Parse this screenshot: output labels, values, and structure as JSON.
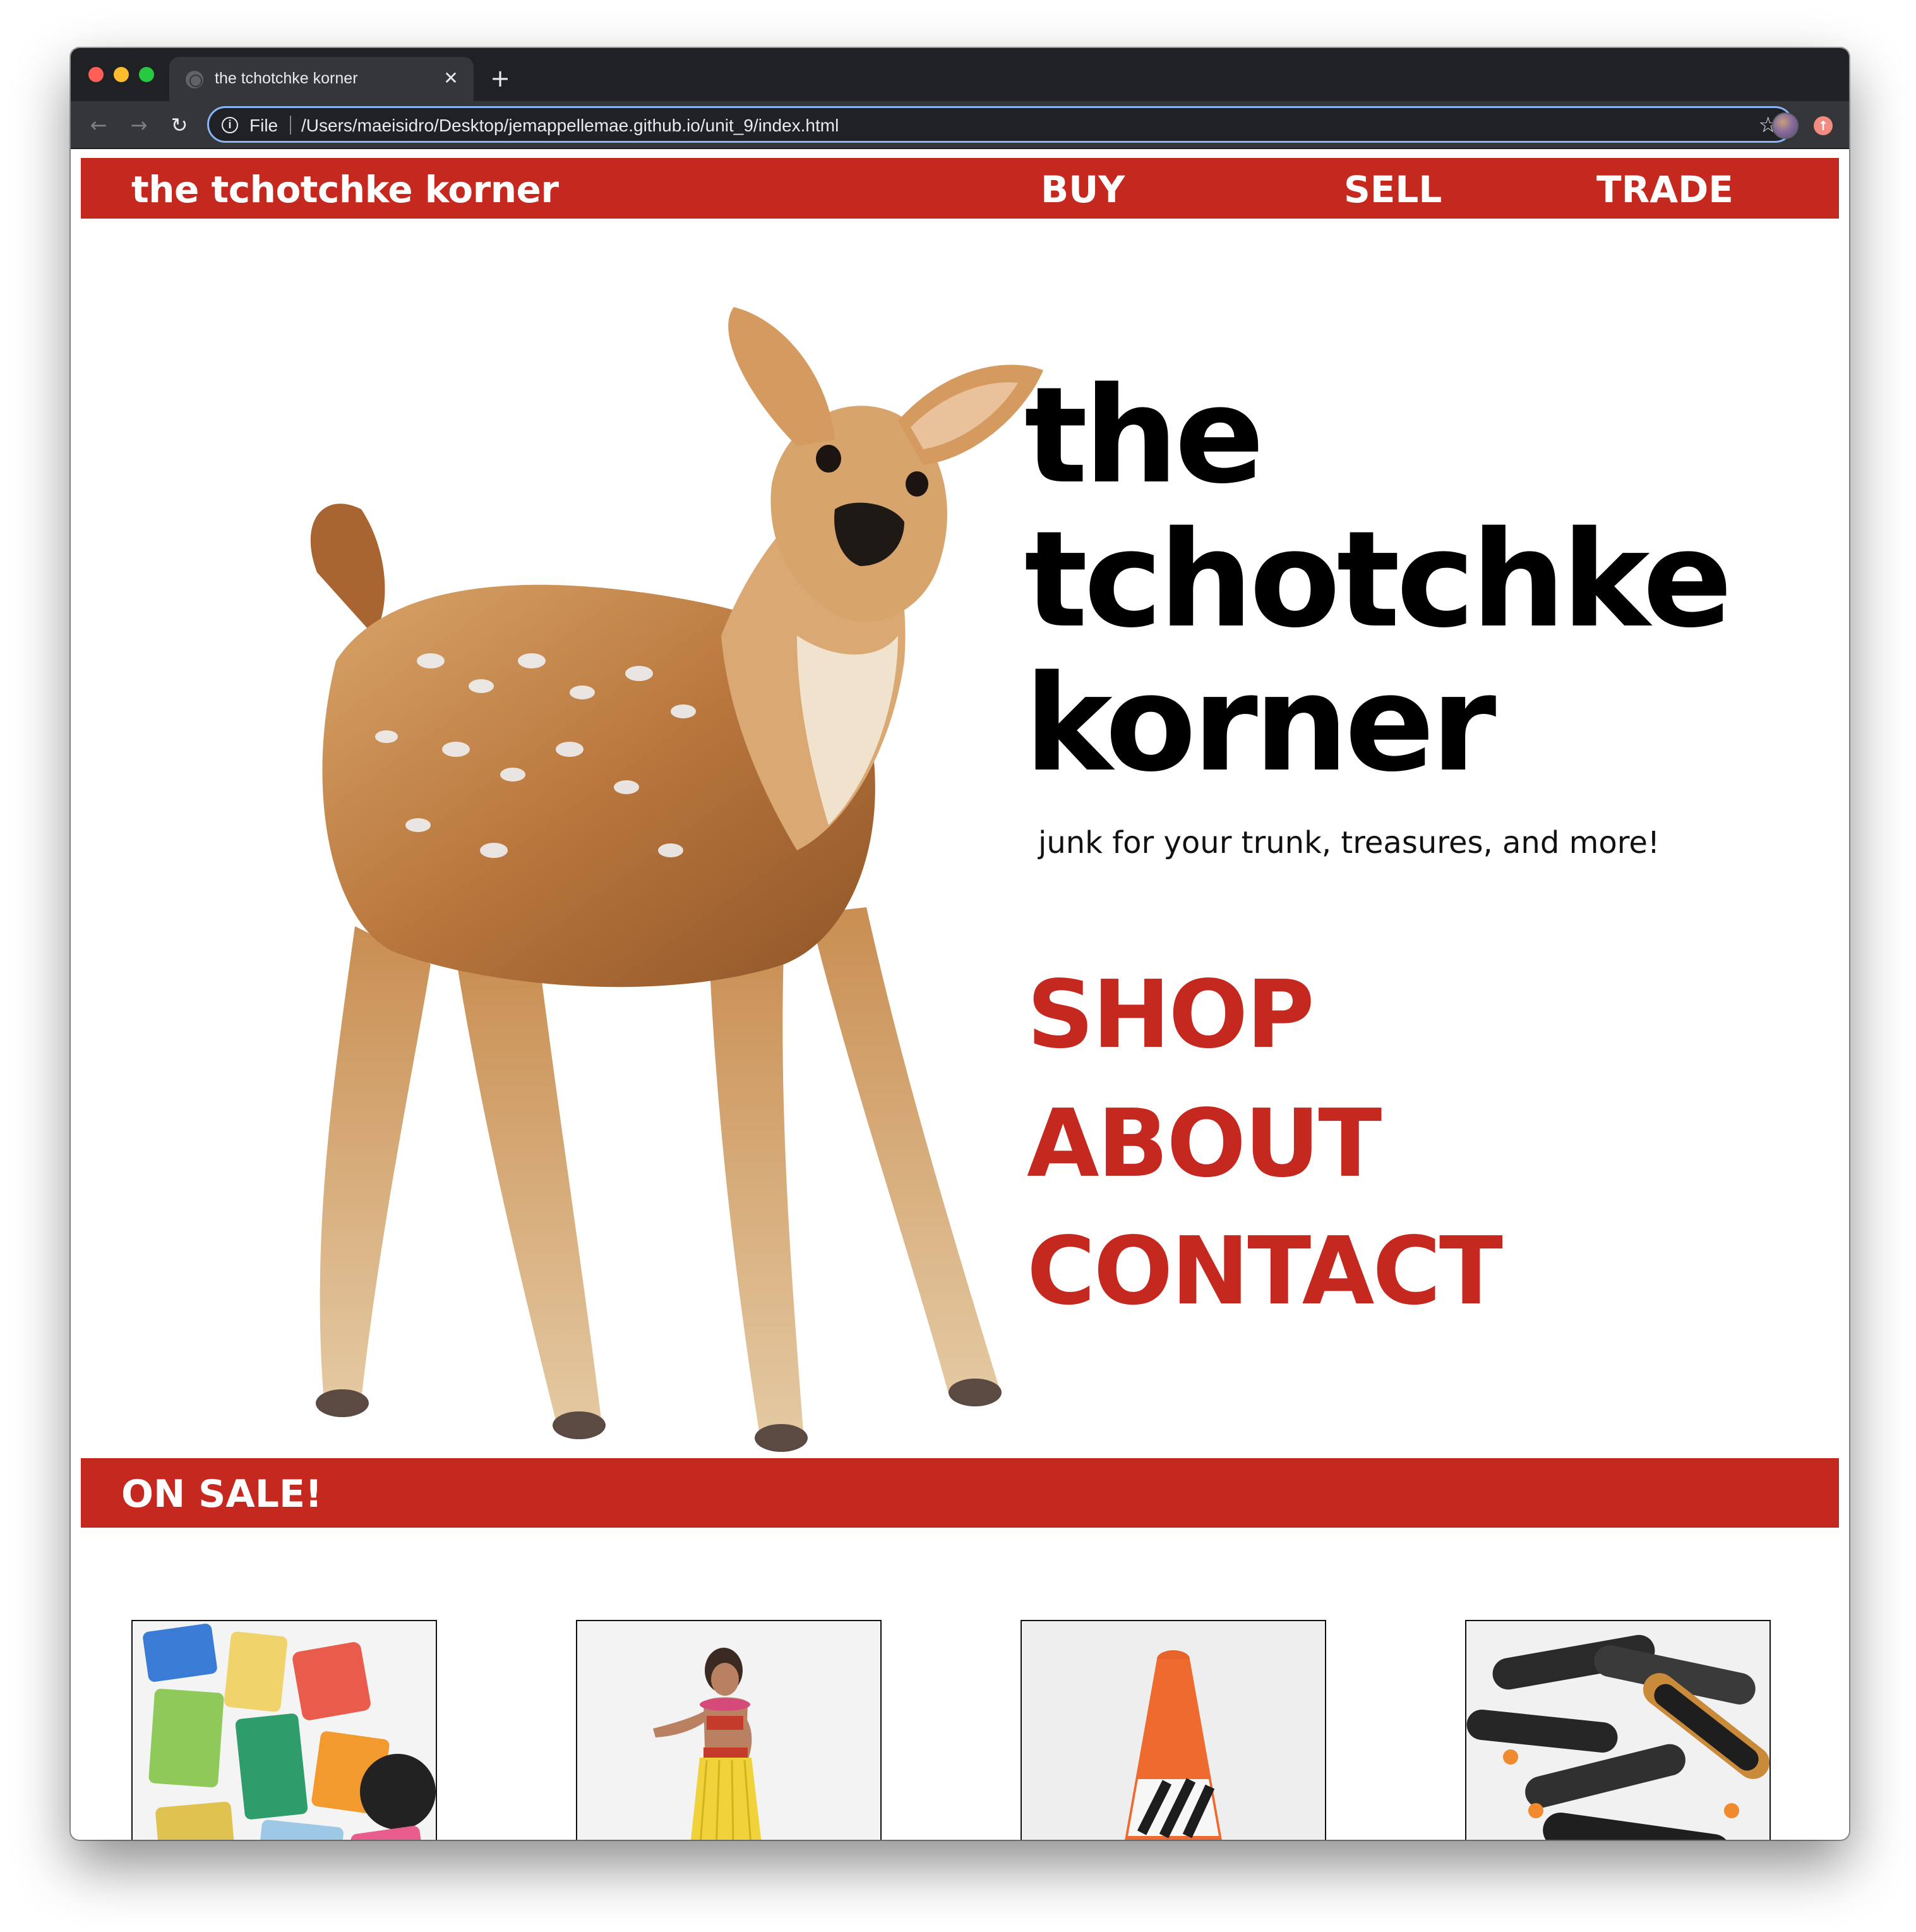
{
  "browser": {
    "tab_title": "the tchotchke korner",
    "tab_close": "✕",
    "new_tab": "+",
    "scheme_label": "File",
    "url": "/Users/maeisidro/Desktop/jemappellemae.github.io/unit_9/index.html",
    "icons": {
      "back": "arrow-left-icon",
      "forward": "arrow-right-icon",
      "reload": "reload-icon",
      "info": "info-icon",
      "bookmark": "star-icon",
      "update": "update-icon"
    }
  },
  "site": {
    "brand": "the tchotchke korner",
    "nav": [
      {
        "label": "BUY"
      },
      {
        "label": "SELL"
      },
      {
        "label": "TRADE"
      }
    ],
    "hero": {
      "title_lines": [
        "the",
        "tchotchke",
        "korner"
      ],
      "tagline": "junk for your trunk, treasures, and more!",
      "links": [
        {
          "label": "SHOP"
        },
        {
          "label": "ABOUT"
        },
        {
          "label": "CONTACT"
        }
      ]
    },
    "sale": {
      "title": "ON SALE!"
    },
    "products": [
      {
        "image": "sticker-collection"
      },
      {
        "image": "hula-dancer-figurine"
      },
      {
        "image": "traffic-cone"
      },
      {
        "image": "fingerboard-skateboards"
      }
    ],
    "colors": {
      "accent": "#c5281f",
      "text": "#000000",
      "background": "#ffffff"
    }
  }
}
